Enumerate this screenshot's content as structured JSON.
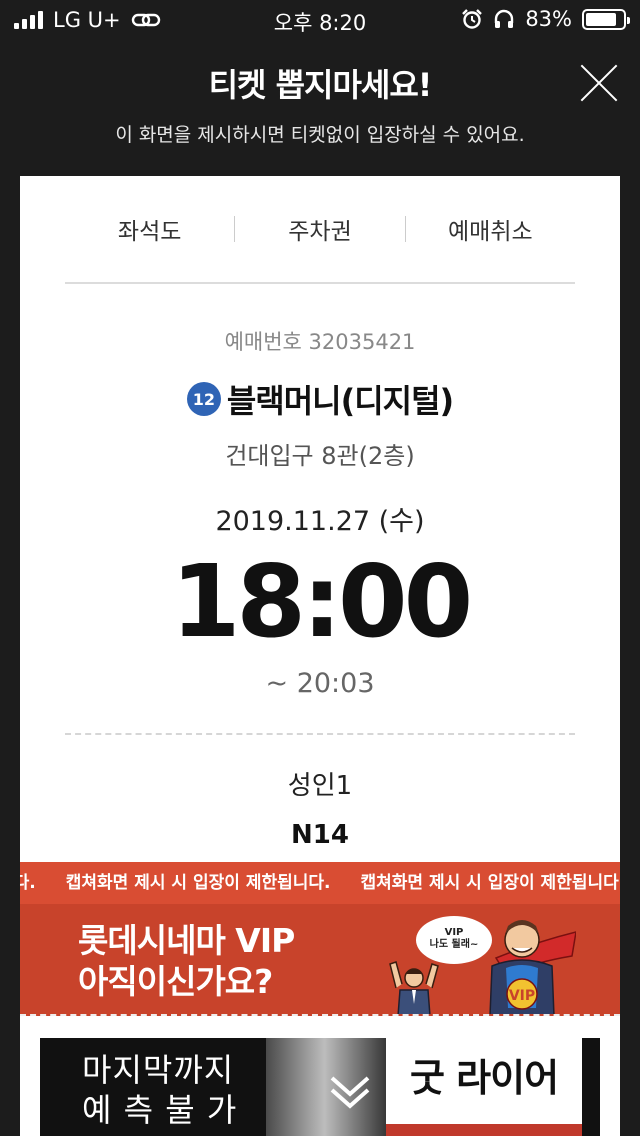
{
  "status_bar": {
    "carrier": "LG U+",
    "time": "오후 8:20",
    "battery": "83%",
    "battery_level": 0.83
  },
  "header": {
    "title": "티켓 뽑지마세요!",
    "subtitle": "이 화면을 제시하시면 티켓없이 입장하실 수 있어요."
  },
  "tabs": [
    "좌석도",
    "주차권",
    "예매취소"
  ],
  "ticket": {
    "booking_label": "예매번호 32035421",
    "age_rating": "12",
    "movie_title": "블랙머니(디지털)",
    "theater": "건대입구 8관(2층)",
    "date": "2019.11.27 (수)",
    "start_time": "18:00",
    "end_time": "~ 20:03",
    "audience": "성인1",
    "seat": "N14"
  },
  "notice": {
    "leading": "니다.",
    "message": "캡쳐화면 제시 시 입장이 제한됩니다.",
    "trailing": "캡쳐화면 제시 시 입장이 제"
  },
  "vip_banner": {
    "line1": "롯데시네마 VIP",
    "line2": "아직이신가요?",
    "bubble_line1": "VIP",
    "bubble_line2": "나도 될래~",
    "badge": "VIP",
    "colors": {
      "background": "#c8432b",
      "cape": "#d22a2a"
    }
  },
  "ad": {
    "left_line1": "마지막까지",
    "left_line2": "예 측 불 가",
    "right_text": "굿 라이어"
  }
}
